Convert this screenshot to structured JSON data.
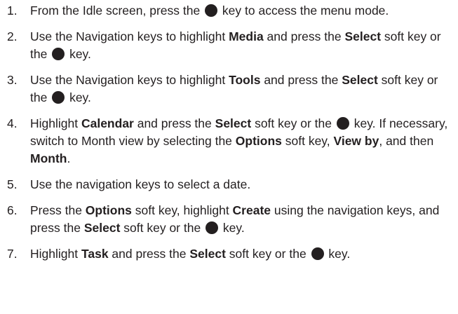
{
  "icons": {
    "dot": "menu-ok-key-icon"
  },
  "steps": [
    {
      "num": "1.",
      "parts": [
        {
          "t": "From the Idle screen, press the "
        },
        {
          "icon": "dot"
        },
        {
          "t": " key to access the menu mode."
        }
      ]
    },
    {
      "num": "2.",
      "parts": [
        {
          "t": "Use the Navigation keys to highlight "
        },
        {
          "b": "Media"
        },
        {
          "t": " and press the "
        },
        {
          "b": "Select"
        },
        {
          "t": " soft key or the "
        },
        {
          "icon": "dot"
        },
        {
          "t": " key."
        }
      ]
    },
    {
      "num": "3.",
      "parts": [
        {
          "t": "Use the Navigation keys to highlight "
        },
        {
          "b": "Tools"
        },
        {
          "t": " and press the "
        },
        {
          "b": "Select"
        },
        {
          "t": " soft key or the "
        },
        {
          "icon": "dot"
        },
        {
          "t": " key."
        }
      ]
    },
    {
      "num": "4.",
      "parts": [
        {
          "t": "Highlight "
        },
        {
          "b": "Calendar"
        },
        {
          "t": " and press the "
        },
        {
          "b": "Select"
        },
        {
          "t": " soft key or the "
        },
        {
          "icon": "dot"
        },
        {
          "t": " key. If necessary, switch to Month view by selecting the "
        },
        {
          "b": "Options"
        },
        {
          "t": " soft key, "
        },
        {
          "b": "View by"
        },
        {
          "t": ", and then "
        },
        {
          "b": "Month"
        },
        {
          "t": "."
        }
      ]
    },
    {
      "num": "5.",
      "parts": [
        {
          "t": "Use the navigation keys to select a date."
        }
      ]
    },
    {
      "num": "6.",
      "parts": [
        {
          "t": "Press the "
        },
        {
          "b": "Options"
        },
        {
          "t": " soft key, highlight "
        },
        {
          "b": "Create"
        },
        {
          "t": " using the navigation keys, and press the "
        },
        {
          "b": "Select"
        },
        {
          "t": " soft key or the "
        },
        {
          "icon": "dot"
        },
        {
          "t": " key."
        }
      ]
    },
    {
      "num": "7.",
      "parts": [
        {
          "t": "Highlight "
        },
        {
          "b": "Task"
        },
        {
          "t": " and press the "
        },
        {
          "b": "Select"
        },
        {
          "t": " soft key or the "
        },
        {
          "icon": "dot"
        },
        {
          "t": " key."
        }
      ]
    }
  ]
}
